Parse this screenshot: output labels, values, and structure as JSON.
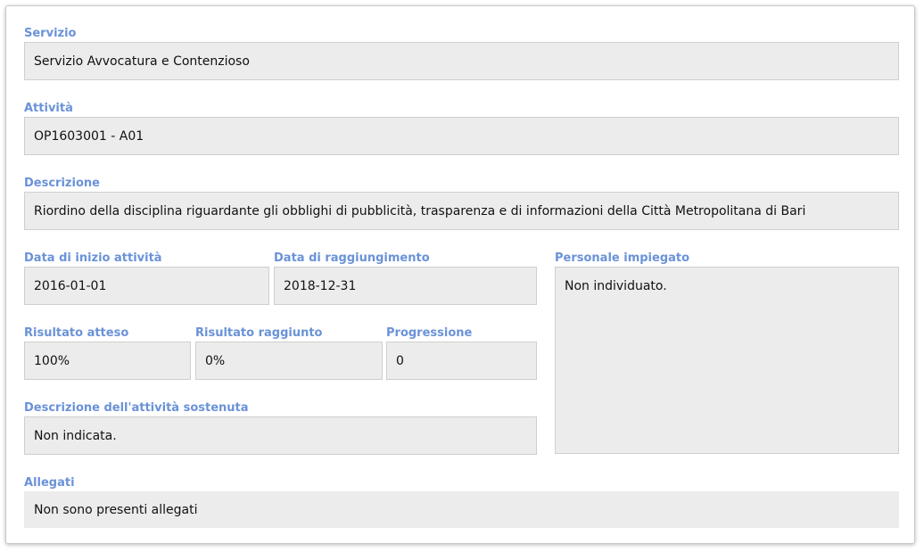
{
  "fields": {
    "servizio": {
      "label": "Servizio",
      "value": "Servizio Avvocatura e Contenzioso"
    },
    "attivita": {
      "label": "Attività",
      "value": "OP1603001 - A01"
    },
    "descrizione": {
      "label": "Descrizione",
      "value": "Riordino della disciplina riguardante gli obblighi di pubblicità, trasparenza e di informazioni della Città Metropolitana di Bari"
    },
    "data_inizio": {
      "label": "Data di inizio attività",
      "value": "2016-01-01"
    },
    "data_raggiungimento": {
      "label": "Data di raggiungimento",
      "value": "2018-12-31"
    },
    "personale": {
      "label": "Personale impiegato",
      "value": "Non individuato."
    },
    "risultato_atteso": {
      "label": "Risultato atteso",
      "value": "100%"
    },
    "risultato_raggiunto": {
      "label": "Risultato raggiunto",
      "value": "0%"
    },
    "progressione": {
      "label": "Progressione",
      "value": "0"
    },
    "descrizione_sostenuta": {
      "label": "Descrizione dell'attività sostenuta",
      "value": "Non indicata."
    },
    "allegati": {
      "label": "Allegati",
      "value": "Non sono presenti allegati"
    }
  }
}
